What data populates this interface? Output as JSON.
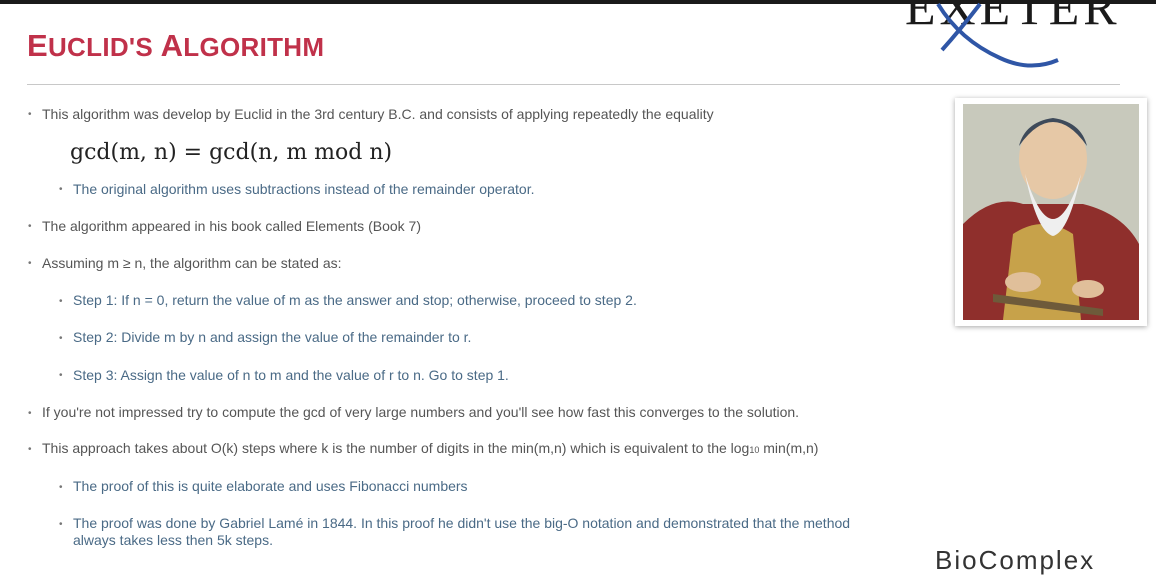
{
  "slide": {
    "title_first_big": "E",
    "title_first_rest": "UCLID'S ",
    "title_second_big": "A",
    "title_second_rest": "LGORITHM",
    "logo_text": "EXETER",
    "footer_logo_text": "BioComplex"
  },
  "bullets": {
    "b1": "This algorithm was develop by Euclid in the 3rd century B.C. and consists of applying repeatedly the equality",
    "formula": "gcd(m, n) = gcd(n, m mod n)",
    "b1_1": "The original algorithm uses subtractions instead of the remainder operator.",
    "b2": "The algorithm appeared in his book called Elements (Book 7)",
    "b3": "Assuming m ≥ n, the algorithm can be stated as:",
    "b3_1": "Step 1: If n = 0, return the value of m as the answer and stop; otherwise, proceed to step 2.",
    "b3_2": "Step 2: Divide m by n and assign the value of the remainder to r.",
    "b3_3": "Step 3: Assign the value of n to m and the value of r to n. Go to step 1.",
    "b4": "If you're not impressed try to compute the gcd of very large numbers and you'll see how fast this converges to the solution.",
    "b5_pre": "This approach takes about O(k) steps where k is the number of digits in the min(m,n) which is equivalent to the log",
    "b5_sub": "10",
    "b5_post": " min(m,n)",
    "b5_1": "The proof of this is quite elaborate and uses Fibonacci numbers",
    "b5_2": "The proof was done by Gabriel Lamé in 1844. In this proof he didn't use the big-O notation and demonstrated that the method always takes less then 5k steps."
  },
  "colors": {
    "title": "#c0314a",
    "body_text": "#555555",
    "sub_text": "#4a6a86",
    "logo_swoosh": "#2f56a6"
  },
  "icons": {
    "portrait": "euclid-portrait-image",
    "logo": "exeter-logo"
  }
}
